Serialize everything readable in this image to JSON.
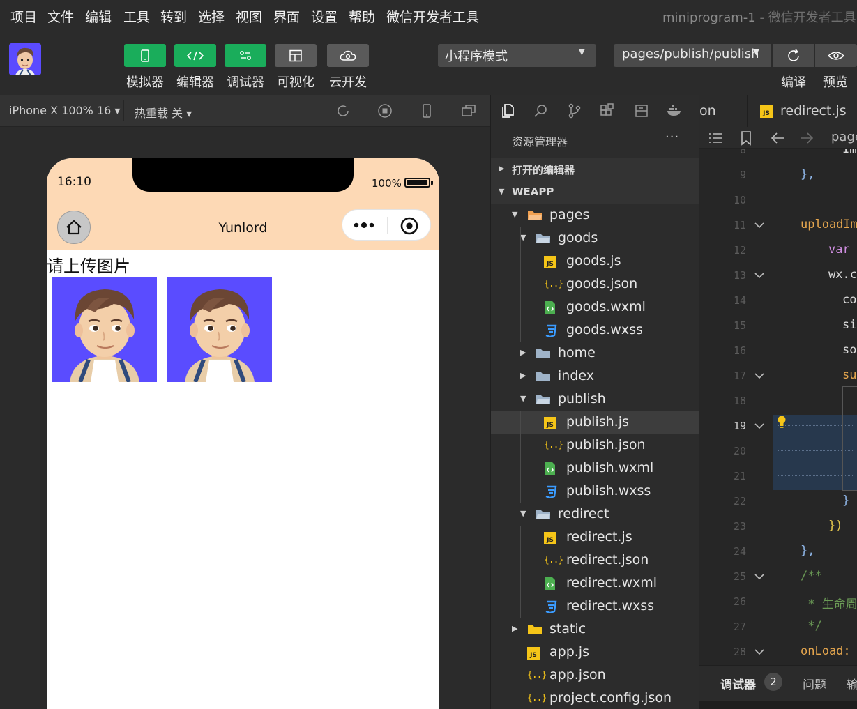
{
  "menu": {
    "items": [
      "项目",
      "文件",
      "编辑",
      "工具",
      "转到",
      "选择",
      "视图",
      "界面",
      "设置",
      "帮助",
      "微信开发者工具"
    ],
    "window_title": "miniprogram-1",
    "window_title_sub": " - 微信开发者工具"
  },
  "toolbar": {
    "buttons": [
      {
        "label": "模拟器",
        "icon": "phone-icon",
        "style": "green"
      },
      {
        "label": "编辑器",
        "icon": "code-icon",
        "style": "green"
      },
      {
        "label": "调试器",
        "icon": "debug-icon",
        "style": "green"
      },
      {
        "label": "可视化",
        "icon": "layout-icon",
        "style": "grey"
      },
      {
        "label": "云开发",
        "icon": "cloud-icon",
        "style": "grey"
      }
    ],
    "mode": "小程序模式",
    "page_path": "pages/publish/publish",
    "compile_label": "编译",
    "preview_label": "预览"
  },
  "simulator_bar": {
    "device": "iPhone X 100% 16 ▾",
    "hot_reload": "热重载 关 ▾"
  },
  "phone": {
    "time": "16:10",
    "battery": "100%",
    "nav_title": "Yunlord",
    "upload_label": "请上传图片",
    "images": [
      {
        "name": "uploaded-image-1"
      },
      {
        "name": "uploaded-image-2"
      }
    ]
  },
  "explorer": {
    "title": "资源管理器",
    "more": "···",
    "open_editors": "打开的编辑器",
    "project": "WEAPP",
    "tree": [
      {
        "label": "pages",
        "type": "folder-open",
        "depth": 0,
        "expanded": true,
        "special": "pages"
      },
      {
        "label": "goods",
        "type": "folder-open",
        "depth": 1,
        "expanded": true
      },
      {
        "label": "goods.js",
        "type": "js",
        "depth": 2
      },
      {
        "label": "goods.json",
        "type": "json",
        "depth": 2
      },
      {
        "label": "goods.wxml",
        "type": "wxml",
        "depth": 2
      },
      {
        "label": "goods.wxss",
        "type": "wxss",
        "depth": 2
      },
      {
        "label": "home",
        "type": "folder",
        "depth": 1,
        "expanded": false
      },
      {
        "label": "index",
        "type": "folder",
        "depth": 1,
        "expanded": false
      },
      {
        "label": "publish",
        "type": "folder-open",
        "depth": 1,
        "expanded": true
      },
      {
        "label": "publish.js",
        "type": "js",
        "depth": 2,
        "selected": true
      },
      {
        "label": "publish.json",
        "type": "json",
        "depth": 2
      },
      {
        "label": "publish.wxml",
        "type": "wxml",
        "depth": 2
      },
      {
        "label": "publish.wxss",
        "type": "wxss",
        "depth": 2
      },
      {
        "label": "redirect",
        "type": "folder-open",
        "depth": 1,
        "expanded": true
      },
      {
        "label": "redirect.js",
        "type": "js",
        "depth": 2
      },
      {
        "label": "redirect.json",
        "type": "json",
        "depth": 2
      },
      {
        "label": "redirect.wxml",
        "type": "wxml",
        "depth": 2
      },
      {
        "label": "redirect.wxss",
        "type": "wxss",
        "depth": 2
      },
      {
        "label": "static",
        "type": "folder-static",
        "depth": 0,
        "expanded": false
      },
      {
        "label": "app.js",
        "type": "js",
        "depth": 0
      },
      {
        "label": "app.json",
        "type": "json",
        "depth": 0
      },
      {
        "label": "project.config.json",
        "type": "json",
        "depth": 0
      }
    ]
  },
  "editor": {
    "tab_partial": "on",
    "tab_active": "redirect.js",
    "breadcrumb_partial": "page",
    "line_numbers": [
      "8",
      "9",
      "10",
      "11",
      "12",
      "13",
      "14",
      "15",
      "16",
      "17",
      "18",
      "19",
      "20",
      "21",
      "22",
      "23",
      "24",
      "25",
      "26",
      "27",
      "28"
    ],
    "active_line": "19",
    "code_lines": [
      {
        "text": "Imag",
        "color": "#dcdcdc",
        "indent": 3
      },
      {
        "text": "},",
        "color": "#8fb6e8",
        "indent": 1
      },
      {
        "text": "",
        "color": "#dcdcdc",
        "indent": 0
      },
      {
        "text": "uploadIma",
        "color": "#e5a64e",
        "indent": 1
      },
      {
        "text": "var t",
        "color": "#cf8ee0",
        "indent": 2
      },
      {
        "text": "wx.ch",
        "color": "#dcdcdc",
        "indent": 2
      },
      {
        "text": "cou",
        "color": "#dcdcdc",
        "indent": 3
      },
      {
        "text": "siz",
        "color": "#dcdcdc",
        "indent": 3
      },
      {
        "text": "sou",
        "color": "#dcdcdc",
        "indent": 3
      },
      {
        "text": "suc",
        "color": "#e5a64e",
        "indent": 3
      },
      {
        "text": "",
        "color": "#dcdcdc",
        "indent": 0
      },
      {
        "text": "",
        "color": "#dcdcdc",
        "indent": 0
      },
      {
        "text": "",
        "color": "#dcdcdc",
        "indent": 0
      },
      {
        "text": "",
        "color": "#dcdcdc",
        "indent": 0
      },
      {
        "text": "}",
        "color": "#8fb6e8",
        "indent": 3
      },
      {
        "text": "})",
        "color": "#e6c84d",
        "indent": 2
      },
      {
        "text": "},",
        "color": "#8fb6e8",
        "indent": 1
      },
      {
        "text": "/**",
        "color": "#6a9955",
        "indent": 1
      },
      {
        "text": " * 生命周",
        "color": "#6a9955",
        "indent": 1
      },
      {
        "text": " */",
        "color": "#6a9955",
        "indent": 1
      },
      {
        "text": "onLoad: f",
        "color": "#e5a64e",
        "indent": 1
      }
    ]
  },
  "debugger": {
    "label": "调试器",
    "badge": "2",
    "problems": "问题",
    "output": "输"
  },
  "colors": {
    "accent_green": "#1aad5b",
    "phone_header": "#fdd9b5",
    "avatar_bg": "#5a4cff",
    "js_yellow": "#f5c518",
    "wxss_blue": "#3b9cff",
    "wxml_green": "#4caf50"
  }
}
